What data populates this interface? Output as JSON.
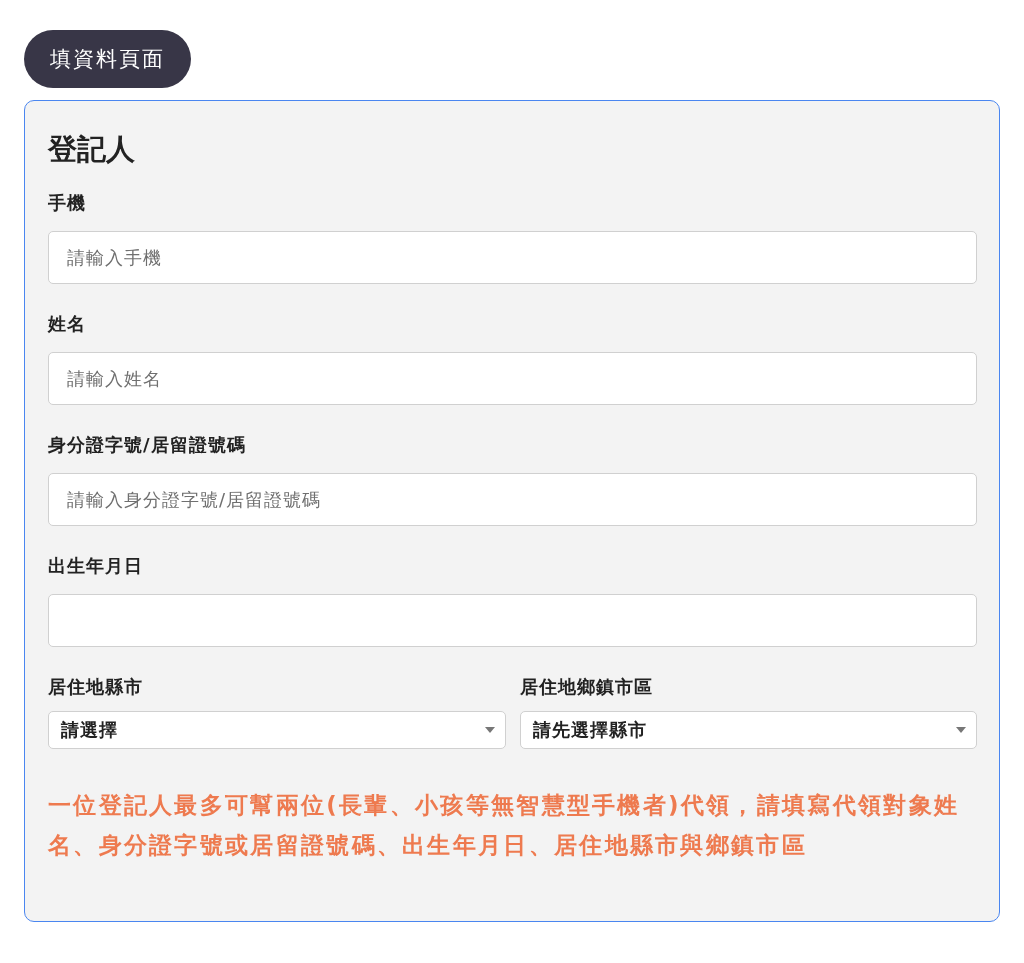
{
  "page_tag": "填資料頁面",
  "section": {
    "title": "登記人",
    "fields": [
      {
        "label": "手機",
        "placeholder": "請輸入手機"
      },
      {
        "label": "姓名",
        "placeholder": "請輸入姓名"
      },
      {
        "label": "身分證字號/居留證號碼",
        "placeholder": "請輸入身分證字號/居留證號碼"
      },
      {
        "label": "出生年月日"
      }
    ],
    "selects": [
      {
        "label": "居住地縣市",
        "value": "請選擇"
      },
      {
        "label": "居住地鄉鎮市區",
        "value": "請先選擇縣市"
      }
    ],
    "note": "一位登記人最多可幫兩位(長輩、小孩等無智慧型手機者)代領，請填寫代領對象姓名、身分證字號或居留證號碼、出生年月日、居住地縣市與鄉鎮市區"
  }
}
